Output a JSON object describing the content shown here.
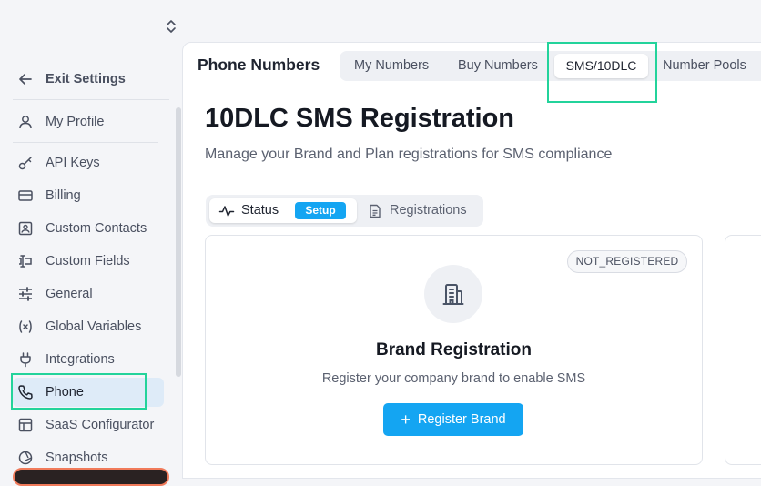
{
  "sidebar": {
    "exit": "Exit Settings",
    "items": [
      {
        "label": "My Profile",
        "icon": "user-icon"
      },
      {
        "label": "API Keys",
        "icon": "key-icon"
      },
      {
        "label": "Billing",
        "icon": "credit-card-icon"
      },
      {
        "label": "Custom Contacts",
        "icon": "contact-card-icon"
      },
      {
        "label": "Custom Fields",
        "icon": "text-field-icon"
      },
      {
        "label": "General",
        "icon": "sliders-icon"
      },
      {
        "label": "Global Variables",
        "icon": "variable-icon"
      },
      {
        "label": "Integrations",
        "icon": "plug-icon"
      },
      {
        "label": "Phone",
        "icon": "phone-icon",
        "active": true
      },
      {
        "label": "SaaS Configurator",
        "icon": "layout-icon"
      },
      {
        "label": "Snapshots",
        "icon": "snapshot-icon"
      }
    ]
  },
  "header": {
    "title": "Phone Numbers",
    "tabs": [
      {
        "label": "My Numbers"
      },
      {
        "label": "Buy Numbers"
      },
      {
        "label": "SMS/10DLC",
        "active": true
      },
      {
        "label": "Number Pools"
      }
    ]
  },
  "page": {
    "title": "10DLC SMS Registration",
    "subtitle": "Manage your Brand and Plan registrations for SMS compliance"
  },
  "subtabs": {
    "status": "Status",
    "status_badge": "Setup",
    "registrations": "Registrations"
  },
  "brand_card": {
    "status": "NOT_REGISTERED",
    "title": "Brand Registration",
    "description": "Register your company brand to enable SMS",
    "button": "Register Brand",
    "icon": "building-icon"
  },
  "colors": {
    "accent": "#14a5f2",
    "highlight": "#23d39b",
    "active_nav_bg": "#deebf8"
  }
}
